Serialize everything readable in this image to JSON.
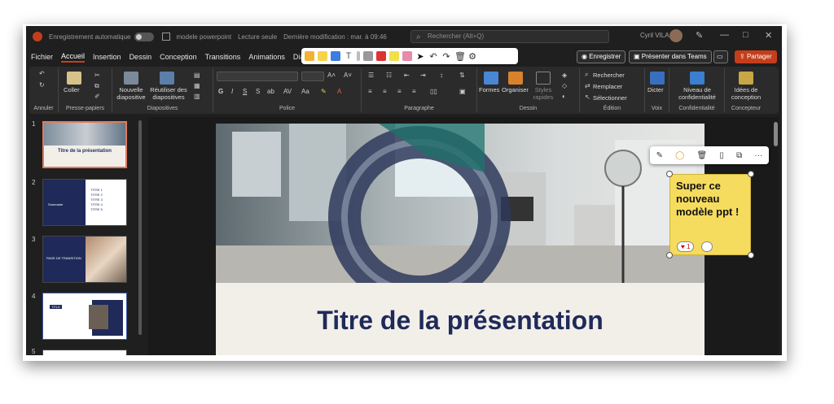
{
  "titlebar": {
    "autosave_label": "Enregistrement automatique",
    "doc_title": "modele powerpoint",
    "mode": "Lecture seule",
    "last_modified": "Dernière modification : mar. à 09:46",
    "search_placeholder": "Rechercher (Alt+Q)",
    "user_name": "Cyril VILA"
  },
  "tabs": [
    "Fichier",
    "Accueil",
    "Insertion",
    "Dessin",
    "Conception",
    "Transitions",
    "Animations",
    "Diaporama"
  ],
  "actions": {
    "save_label": "Enregistrer",
    "present_teams_label": "Présenter dans Teams",
    "share_label": "Partager"
  },
  "ribbon": {
    "groups": [
      "Annuler",
      "Presse-papiers",
      "Diapositives",
      "Police",
      "Paragraphe",
      "Dessin",
      "Édition",
      "Voix",
      "Confidentialité",
      "Concepteur"
    ],
    "coller": "Coller",
    "nouvelle": "Nouvelle diapositive",
    "reutiliser": "Réutiliser des diapositives",
    "formes": "Formes",
    "organiser": "Organiser",
    "styles": "Styles rapides",
    "rechercher": "Rechercher",
    "remplacer": "Remplacer",
    "selectionner": "Sélectionner",
    "dicter": "Dicter",
    "niveau": "Niveau de confidentialité",
    "idees": "Idées de conception"
  },
  "thumbnails": [
    {
      "num": "1",
      "title": "Titre de la présentation"
    },
    {
      "num": "2",
      "title": "Sommaire",
      "items": [
        "TITRE 1",
        "TITRE 2",
        "TITRE 3",
        "TITRE 4",
        "TITRE 5"
      ]
    },
    {
      "num": "3",
      "title": "PAGE DE TRANSITION"
    },
    {
      "num": "4",
      "title": "TITLE"
    },
    {
      "num": "5"
    }
  ],
  "slide": {
    "title": "Titre de la présentation"
  },
  "sticky": {
    "text": "Super ce nouveau modèle ppt !",
    "reaction_count": "1"
  },
  "colors": {
    "accent": "#c43e1c",
    "navy": "#1f2a5a",
    "note": "#f6dc5e"
  }
}
